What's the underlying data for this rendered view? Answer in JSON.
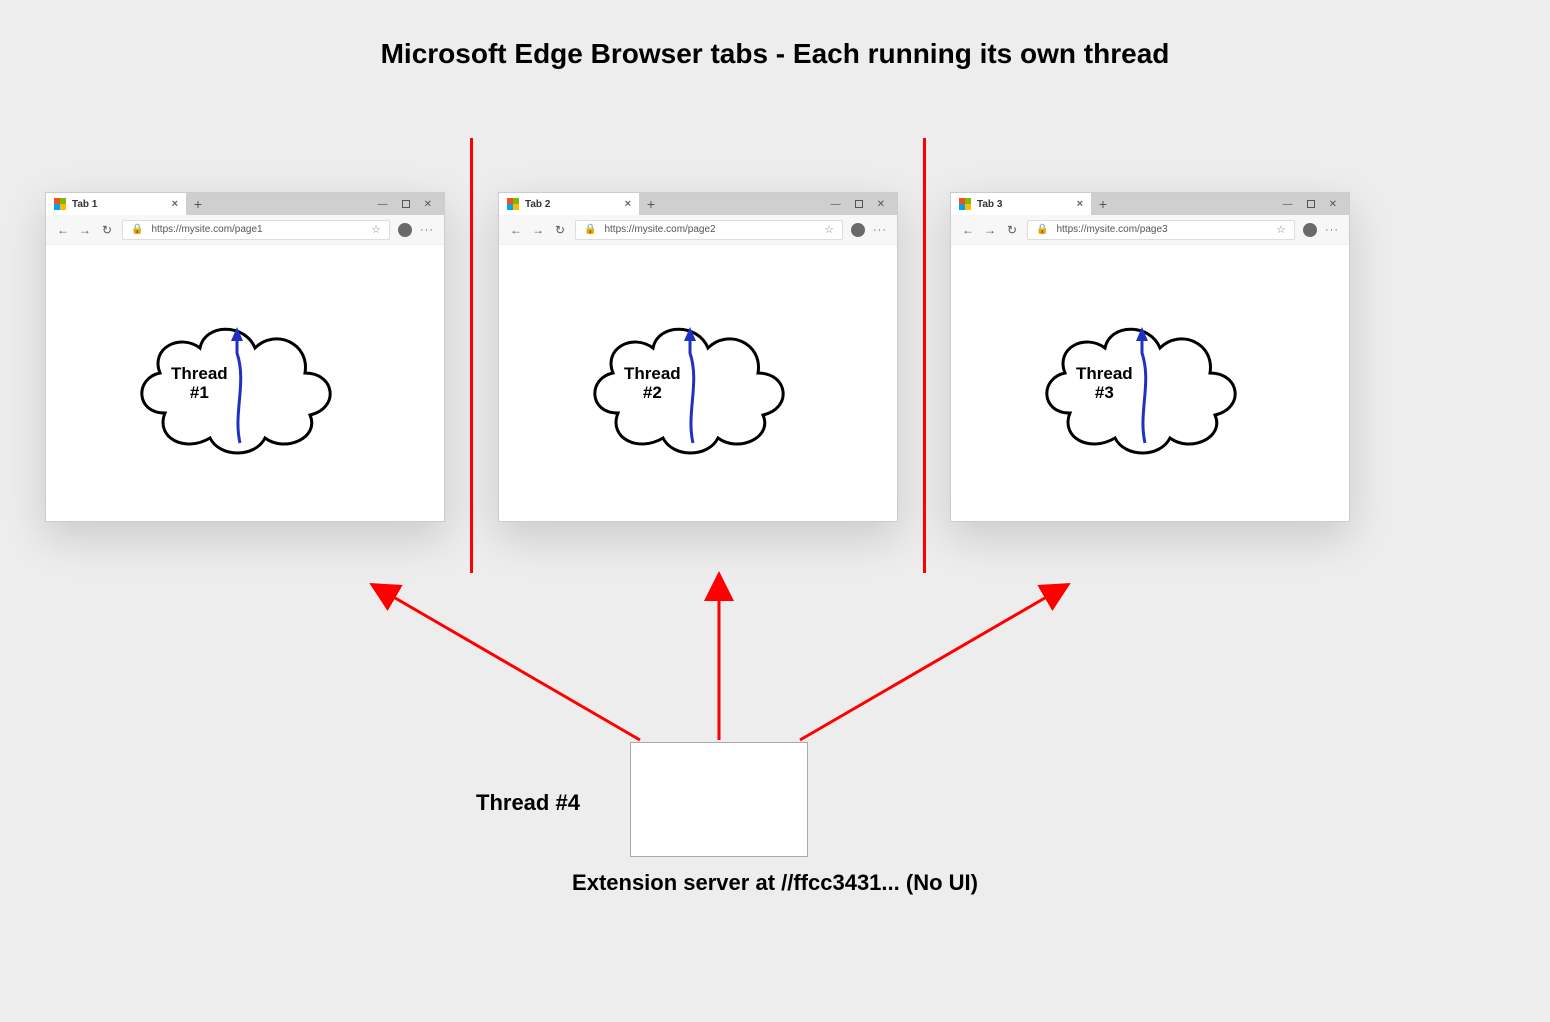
{
  "title": "Microsoft Edge Browser tabs - Each running its own thread",
  "windows": [
    {
      "tab": "Tab 1",
      "url": "https://mysite.com/page1",
      "thread_line1": "Thread",
      "thread_line2": "#1"
    },
    {
      "tab": "Tab 2",
      "url": "https://mysite.com/page2",
      "thread_line1": "Thread",
      "thread_line2": "#2"
    },
    {
      "tab": "Tab 3",
      "url": "https://mysite.com/page3",
      "thread_line1": "Thread",
      "thread_line2": "#3"
    }
  ],
  "server": {
    "thread_label": "Thread #4",
    "caption": "Extension server at //ffcc3431... (No UI)"
  },
  "glyphs": {
    "close": "×",
    "plus": "+",
    "minimize": "—",
    "wclose": "✕",
    "back": "←",
    "forward": "→",
    "refresh": "↻",
    "lock": "🔒",
    "star": "☆",
    "more": "···"
  }
}
